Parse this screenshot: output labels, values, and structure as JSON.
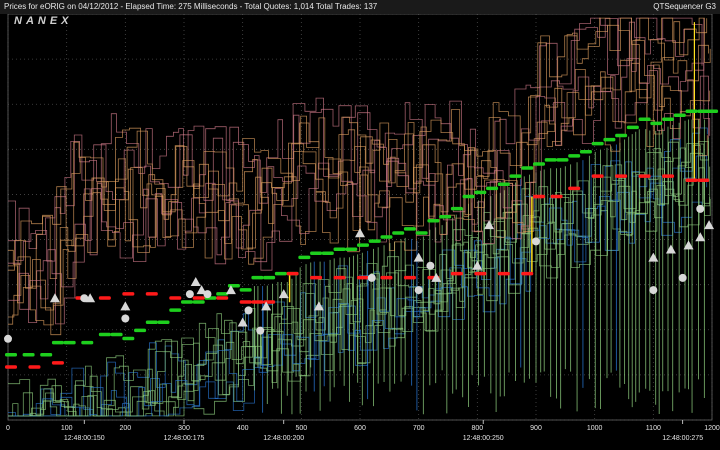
{
  "window": {
    "title": "Prices for  eORIG  on  04/12/2012  -  Elapsed Time: 275 Milliseconds  -  Total Quotes: 1,014  Total Trades: 137",
    "app_name": "QTSequencer G3",
    "logo": "NANEX"
  },
  "colors": {
    "background": "#000000",
    "grid": "#4a4a4a",
    "axis_text": "#e6e6e6",
    "bid_level": "#1ecf1e",
    "ask_level": "#ff1a1a",
    "exchange_bids": "#8fcf7f",
    "exchange_bids_blue": "#2a7ad8",
    "exchange_asks": "#e0a060",
    "exchange_asks_pink": "#d07a8a",
    "trades": "#d8d8d8",
    "yellow_tick": "#ffe020"
  },
  "chart_data": {
    "type": "scatter",
    "title": "",
    "xlabel": "",
    "ylabel": "",
    "xlim": [
      0,
      1200
    ],
    "x_ticks": [
      "0",
      "100",
      "200",
      "300",
      "400",
      "500",
      "600",
      "700",
      "800",
      "900",
      "1000",
      "1100",
      "1200"
    ],
    "x_time_labels": [
      {
        "x": 130,
        "label": "12:48:00:150"
      },
      {
        "x": 300,
        "label": "12:48:00:175"
      },
      {
        "x": 470,
        "label": "12:48:00:200"
      },
      {
        "x": 810,
        "label": "12:48:00:250"
      },
      {
        "x": 1150,
        "label": "12:48:00:275"
      }
    ],
    "ylim": [
      0,
      100
    ],
    "grid": true,
    "series": [
      {
        "color_key": "bid_level",
        "marker": "dash",
        "points": [
          [
            0,
            16
          ],
          [
            30,
            16
          ],
          [
            60,
            16
          ],
          [
            80,
            19
          ],
          [
            100,
            19
          ],
          [
            130,
            19
          ],
          [
            160,
            21
          ],
          [
            180,
            21
          ],
          [
            200,
            20
          ],
          [
            220,
            22
          ],
          [
            240,
            24
          ],
          [
            260,
            24
          ],
          [
            280,
            27
          ],
          [
            300,
            29
          ],
          [
            320,
            29
          ],
          [
            340,
            30
          ],
          [
            360,
            31
          ],
          [
            380,
            33
          ],
          [
            400,
            32
          ],
          [
            420,
            35
          ],
          [
            440,
            35
          ],
          [
            460,
            36
          ],
          [
            480,
            36
          ],
          [
            500,
            40
          ],
          [
            520,
            41
          ],
          [
            540,
            41
          ],
          [
            560,
            42
          ],
          [
            580,
            42
          ],
          [
            600,
            43
          ],
          [
            620,
            44
          ],
          [
            640,
            45
          ],
          [
            660,
            46
          ],
          [
            680,
            47
          ],
          [
            700,
            46
          ],
          [
            720,
            49
          ],
          [
            740,
            50
          ],
          [
            760,
            52
          ],
          [
            780,
            55
          ],
          [
            800,
            56
          ],
          [
            820,
            57
          ],
          [
            840,
            58
          ],
          [
            860,
            60
          ],
          [
            880,
            62
          ],
          [
            900,
            63
          ],
          [
            920,
            64
          ],
          [
            940,
            64
          ],
          [
            960,
            65
          ],
          [
            980,
            66
          ],
          [
            1000,
            68
          ],
          [
            1020,
            69
          ],
          [
            1040,
            70
          ],
          [
            1060,
            72
          ],
          [
            1080,
            74
          ],
          [
            1100,
            73
          ],
          [
            1120,
            74
          ],
          [
            1140,
            75
          ],
          [
            1160,
            76
          ],
          [
            1180,
            76
          ],
          [
            1195,
            76
          ]
        ]
      },
      {
        "color_key": "ask_level",
        "marker": "dash",
        "points": [
          [
            0,
            13
          ],
          [
            40,
            13
          ],
          [
            80,
            14
          ],
          [
            120,
            30
          ],
          [
            160,
            30
          ],
          [
            200,
            31
          ],
          [
            240,
            31
          ],
          [
            280,
            30
          ],
          [
            320,
            30
          ],
          [
            360,
            30
          ],
          [
            400,
            29
          ],
          [
            420,
            29
          ],
          [
            440,
            29
          ],
          [
            480,
            36
          ],
          [
            520,
            35
          ],
          [
            560,
            35
          ],
          [
            600,
            35
          ],
          [
            640,
            35
          ],
          [
            680,
            35
          ],
          [
            720,
            35
          ],
          [
            760,
            36
          ],
          [
            800,
            36
          ],
          [
            840,
            36
          ],
          [
            880,
            36
          ],
          [
            900,
            55
          ],
          [
            930,
            55
          ],
          [
            960,
            57
          ],
          [
            1000,
            60
          ],
          [
            1040,
            60
          ],
          [
            1080,
            60
          ],
          [
            1120,
            60
          ],
          [
            1160,
            59
          ],
          [
            1180,
            59
          ]
        ]
      },
      {
        "color_key": "trades",
        "marker": "triangle",
        "points": [
          [
            80,
            30
          ],
          [
            140,
            30
          ],
          [
            200,
            28
          ],
          [
            320,
            34
          ],
          [
            330,
            32
          ],
          [
            380,
            32
          ],
          [
            400,
            24
          ],
          [
            440,
            28
          ],
          [
            470,
            31
          ],
          [
            530,
            28
          ],
          [
            600,
            46
          ],
          [
            700,
            40
          ],
          [
            730,
            35
          ],
          [
            800,
            38
          ],
          [
            820,
            48
          ],
          [
            1100,
            40
          ],
          [
            1130,
            42
          ],
          [
            1160,
            43
          ],
          [
            1180,
            45
          ],
          [
            1195,
            48
          ]
        ]
      },
      {
        "color_key": "trades",
        "marker": "circle",
        "points": [
          [
            0,
            20
          ],
          [
            130,
            30
          ],
          [
            200,
            25
          ],
          [
            310,
            31
          ],
          [
            340,
            31
          ],
          [
            410,
            27
          ],
          [
            430,
            22
          ],
          [
            620,
            35
          ],
          [
            700,
            32
          ],
          [
            720,
            38
          ],
          [
            900,
            44
          ],
          [
            1100,
            32
          ],
          [
            1150,
            35
          ],
          [
            1180,
            52
          ]
        ]
      }
    ]
  }
}
